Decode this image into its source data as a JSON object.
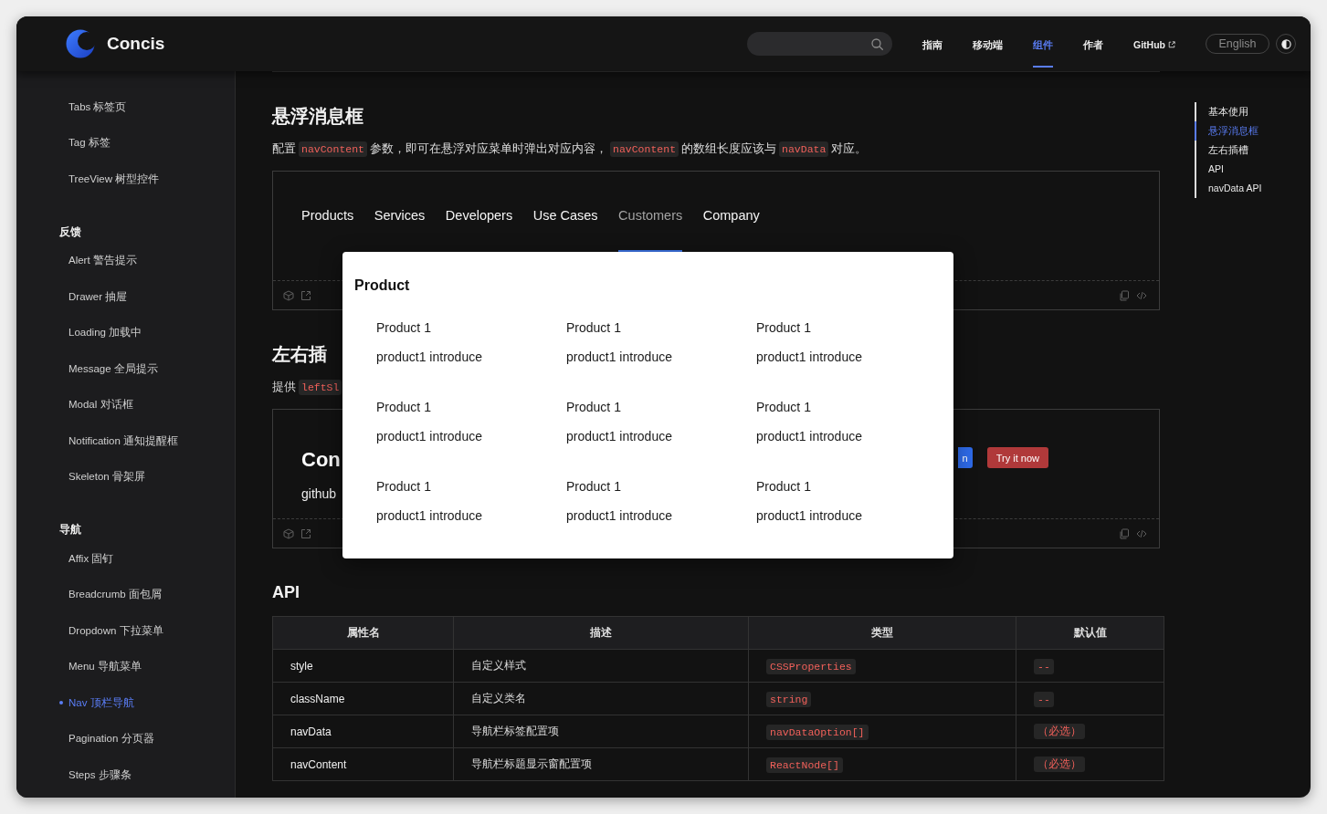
{
  "header": {
    "logo_text": "Concis",
    "nav": [
      {
        "label": "指南",
        "selected": false,
        "external": false
      },
      {
        "label": "移动端",
        "selected": false,
        "external": false
      },
      {
        "label": "组件",
        "selected": true,
        "external": false
      },
      {
        "label": "作者",
        "selected": false,
        "external": false
      },
      {
        "label": "GitHub",
        "selected": false,
        "external": true
      }
    ],
    "language": "English"
  },
  "sidebar": {
    "groups": [
      {
        "items": [
          {
            "label": "Tabs 标签页",
            "selected": false
          },
          {
            "label": "Tag 标签",
            "selected": false
          },
          {
            "label": "TreeView 树型控件",
            "selected": false
          }
        ]
      },
      {
        "title": "反馈",
        "items": [
          {
            "label": "Alert 警告提示",
            "selected": false
          },
          {
            "label": "Drawer 抽屉",
            "selected": false
          },
          {
            "label": "Loading 加载中",
            "selected": false
          },
          {
            "label": "Message 全局提示",
            "selected": false
          },
          {
            "label": "Modal 对话框",
            "selected": false
          },
          {
            "label": "Notification 通知提醒框",
            "selected": false
          },
          {
            "label": "Skeleton 骨架屏",
            "selected": false
          }
        ]
      },
      {
        "title": "导航",
        "items": [
          {
            "label": "Affix 固钉",
            "selected": false
          },
          {
            "label": "Breadcrumb 面包屑",
            "selected": false
          },
          {
            "label": "Dropdown 下拉菜单",
            "selected": false
          },
          {
            "label": "Menu 导航菜单",
            "selected": false
          },
          {
            "label": "Nav 顶栏导航",
            "selected": true
          },
          {
            "label": "Pagination 分页器",
            "selected": false
          },
          {
            "label": "Steps 步骤条",
            "selected": false
          }
        ]
      }
    ]
  },
  "content": {
    "sections": [
      {
        "kind": "nav_demo",
        "title": "悬浮消息框",
        "description": [
          {
            "kind": "text",
            "text": "配置"
          },
          {
            "kind": "code",
            "text": "navContent"
          },
          {
            "kind": "text",
            "text": "参数，即可在悬浮对应菜单时弹出对应内容，"
          },
          {
            "kind": "code",
            "text": "navContent"
          },
          {
            "kind": "text",
            "text": "的数组长度应该与"
          },
          {
            "kind": "code",
            "text": "navData"
          },
          {
            "kind": "text",
            "text": "对应。"
          }
        ],
        "demo": {
          "nav": [
            {
              "label": "Products",
              "selected": false
            },
            {
              "label": "Services",
              "selected": false
            },
            {
              "label": "Developers",
              "selected": false
            },
            {
              "label": "Use Cases",
              "selected": false
            },
            {
              "label": "Customers",
              "selected": true
            },
            {
              "label": "Company",
              "selected": false
            }
          ],
          "popup": {
            "title": "Product",
            "items": [
              {
                "name": "Product 1",
                "intro": "product1 introduce"
              },
              {
                "name": "Product 1",
                "intro": "product1 introduce"
              },
              {
                "name": "Product 1",
                "intro": "product1 introduce"
              },
              {
                "name": "Product 1",
                "intro": "product1 introduce"
              },
              {
                "name": "Product 1",
                "intro": "product1 introduce"
              },
              {
                "name": "Product 1",
                "intro": "product1 introduce"
              },
              {
                "name": "Product 1",
                "intro": "product1 introduce"
              },
              {
                "name": "Product 1",
                "intro": "product1 introduce"
              },
              {
                "name": "Product 1",
                "intro": "product1 introduce"
              }
            ]
          }
        }
      },
      {
        "kind": "slot_demo",
        "title": "左右插",
        "description": [
          {
            "kind": "text",
            "text": "提供"
          },
          {
            "kind": "code",
            "text": "leftSl"
          }
        ],
        "demo": {
          "brand": "Con",
          "subtitle": "github",
          "buttons": [
            {
              "label": "n",
              "kind": "primary"
            },
            {
              "label": "Try it now",
              "kind": "danger"
            }
          ]
        }
      }
    ],
    "api": {
      "title": "API",
      "columns": [
        {
          "label": "属性名",
          "kind": "text"
        },
        {
          "label": "描述",
          "kind": "text"
        },
        {
          "label": "类型",
          "kind": "code"
        },
        {
          "label": "默认值",
          "kind": "code"
        }
      ],
      "rows": [
        [
          "style",
          "自定义样式",
          "CSSProperties",
          "--"
        ],
        [
          "className",
          "自定义类名",
          "string",
          "--"
        ],
        [
          "navData",
          "导航栏标签配置项",
          "navDataOption[]",
          "（必选）"
        ],
        [
          "navContent",
          "导航栏标题显示窗配置项",
          "ReactNode[]",
          "（必选）"
        ]
      ]
    }
  },
  "toc": {
    "items": [
      {
        "label": "基本使用",
        "selected": false
      },
      {
        "label": "悬浮消息框",
        "selected": true
      },
      {
        "label": "左右插槽",
        "selected": false
      },
      {
        "label": "API",
        "selected": false
      },
      {
        "label": "navData API",
        "selected": false
      }
    ]
  }
}
